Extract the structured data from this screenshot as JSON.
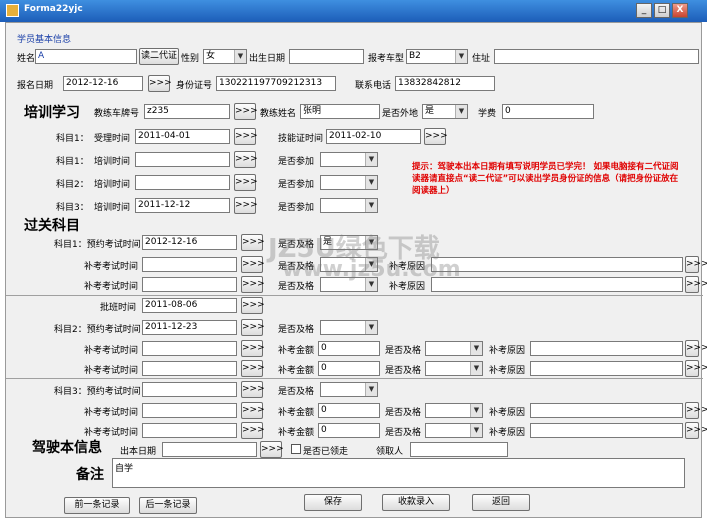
{
  "window": {
    "title": "Forma22yjc",
    "min": "_",
    "max": "□",
    "close": "X"
  },
  "section_basic": "学员基本信息",
  "basic": {
    "name_label": "姓名",
    "name_value": "A",
    "read_id_btn": "读二代证",
    "gender_label": "性别",
    "gender_value": "女",
    "birth_label": "出生日期",
    "birth_value": "",
    "license_type_label": "报考车型",
    "license_type_value": "B2",
    "address_label": "住址",
    "address_value": "",
    "signup_label": "报名日期",
    "signup_value": "2012-12-16",
    "picker": ">>>",
    "id_label": "身份证号",
    "id_value": "130221197709212313",
    "phone_label": "联系电话",
    "phone_value": "13832842812"
  },
  "training": {
    "heading": "培训学习",
    "plate_label": "教练车牌号",
    "plate_value": "z235",
    "coach_label": "教练姓名",
    "coach_value": "张明",
    "outside_label": "是否外地",
    "outside_value": "是",
    "fee_label": "学费",
    "fee_value": "0",
    "rows": [
      {
        "label": "科目1：",
        "field": "受理时间",
        "value": "2011-04-01",
        "extra_label": "技能证时间",
        "extra_value": "2011-02-10"
      },
      {
        "label": "科目1：",
        "field": "培训时间",
        "value": "",
        "extra_label": "是否参加",
        "extra_value": ""
      },
      {
        "label": "科目2：",
        "field": "培训时间",
        "value": "",
        "extra_label": "是否参加",
        "extra_value": ""
      },
      {
        "label": "科目3：",
        "field": "培训时间",
        "value": "2011-12-12",
        "extra_label": "是否参加",
        "extra_value": ""
      }
    ],
    "note": "提示：驾驶本出本日期有填写说明学员已学完！ 如果电脑接有二代证阅读器请直接点“读二代证”可以读出学员身份证的信息（请把身份证放在阅读器上）"
  },
  "exam": {
    "heading": "过关科目",
    "s1_label": "科目1：预约考试时间",
    "s1_value": "2012-12-16",
    "pass_label": "是否及格",
    "s1_pass": "是",
    "retest_label": "补考考试时间",
    "reason_label": "补考原因",
    "fee_label": "补考金额",
    "approve_label": "批班时间",
    "approve_value": "2011-08-06",
    "s2_label": "科目2：预约考试时间",
    "s2_value": "2011-12-23",
    "s3_label": "科目3：预约考试时间",
    "s3_value": "",
    "zero": "0"
  },
  "license": {
    "heading": "驾驶本信息",
    "issue_label": "出本日期",
    "issue_value": "",
    "received_label": "是否已领走",
    "receiver_label": "领取人",
    "receiver_value": ""
  },
  "remark": {
    "heading": "备注",
    "value": "自学"
  },
  "buttons": {
    "prev": "前一条记录",
    "next": "后一条记录",
    "save": "保存",
    "fee": "收款录入",
    "back": "返回"
  },
  "watermark": {
    "line1": "JZ5U绿色下载",
    "line2": "www.jz5u.com"
  }
}
